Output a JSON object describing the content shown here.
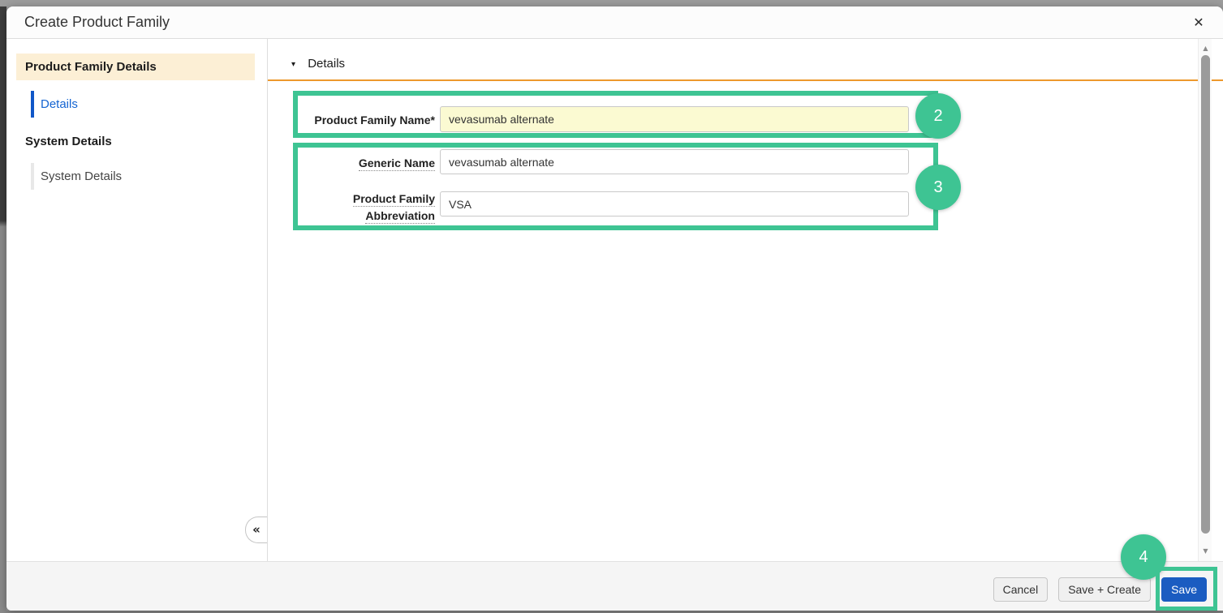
{
  "window": {
    "title": "Create Product Family",
    "close_icon": "✕"
  },
  "sidebar": {
    "groups": [
      {
        "header": "Product Family Details",
        "items": [
          {
            "label": "Details",
            "active": true
          }
        ]
      },
      {
        "header": "System Details",
        "items": [
          {
            "label": "System Details",
            "active": false
          }
        ]
      }
    ],
    "collapse_icon": "«"
  },
  "main": {
    "section": {
      "title": "Details",
      "collapse_icon": "▾"
    },
    "fields": [
      {
        "label": "Product Family Name*",
        "value": "vevasumab alternate",
        "required": true,
        "highlighted": true
      },
      {
        "label": "Generic Name",
        "value": "vevasumab alternate",
        "required": false
      },
      {
        "label": "Product Family Abbreviation",
        "value": "VSA",
        "required": false
      }
    ]
  },
  "footer": {
    "cancel_label": "Cancel",
    "save_create_label": "Save + Create",
    "save_label": "Save"
  },
  "annotations": {
    "step2": "2",
    "step3": "3",
    "step4": "4",
    "highlight_color": "#3ec493"
  },
  "scrollbar": {
    "up_icon": "▲",
    "down_icon": "▼"
  },
  "colors": {
    "annotation_green": "#3ec493",
    "section_divider_orange": "#ed992d",
    "active_sidebar_item_bg": "#fcefd5",
    "sidebar_link_blue": "#1464d2",
    "primary_button_blue": "#1b5cc1",
    "required_field_bg": "#fbfad2"
  }
}
